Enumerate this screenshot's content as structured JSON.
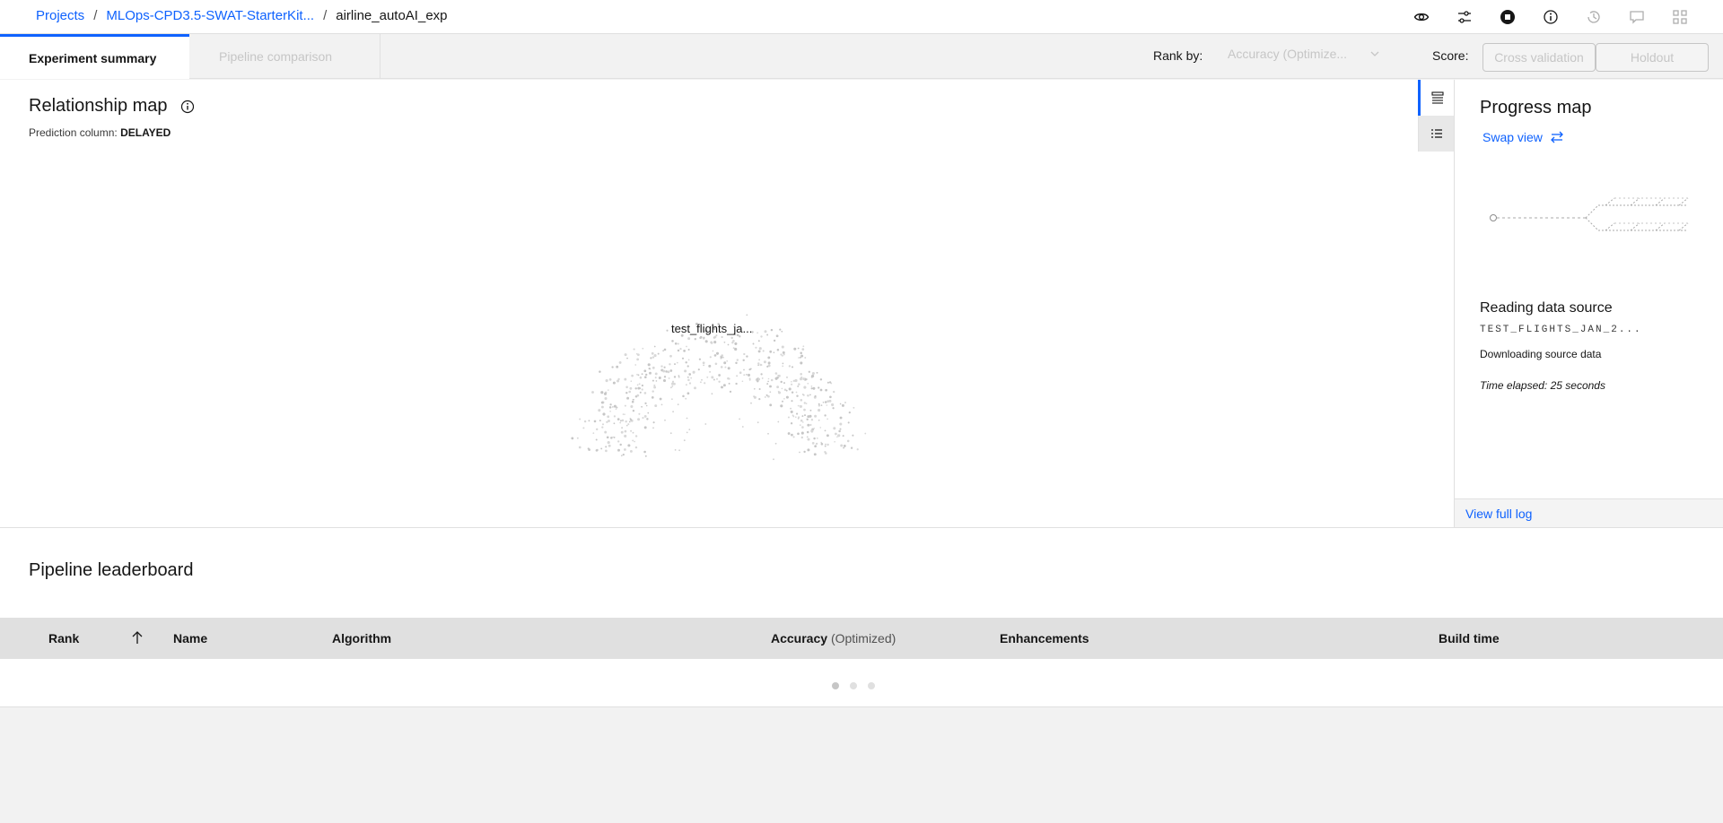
{
  "breadcrumb": {
    "items": [
      "Projects",
      "MLOps-CPD3.5-SWAT-StarterKit...",
      "airline_autoAI_exp"
    ],
    "separator": "/"
  },
  "toolbar": {
    "icons": [
      "eye-icon",
      "settings-adjust-icon",
      "stop-icon",
      "information-icon",
      "history-icon",
      "chat-icon",
      "data-structure-icon"
    ]
  },
  "tabs": {
    "experiment_summary": "Experiment summary",
    "pipeline_comparison": "Pipeline comparison"
  },
  "rank": {
    "label": "Rank by:",
    "selected": "Accuracy (Optimize..."
  },
  "score": {
    "label": "Score:",
    "cross_validation": "Cross validation",
    "holdout": "Holdout"
  },
  "relationship_map": {
    "title": "Relationship map",
    "prediction_label": "Prediction column:",
    "prediction_value": "DELAYED",
    "node_label": "test_flights_ja..."
  },
  "progress_map": {
    "title": "Progress map",
    "swap_view": "Swap view",
    "stage_title": "Reading data source",
    "source_name": "TEST_FLIGHTS_JAN_2...",
    "status": "Downloading source data",
    "elapsed": "Time elapsed: 25 seconds",
    "view_log": "View full log"
  },
  "leaderboard": {
    "title": "Pipeline leaderboard",
    "columns": {
      "rank": "Rank",
      "name": "Name",
      "algorithm": "Algorithm",
      "accuracy": "Accuracy",
      "accuracy_note": "(Optimized)",
      "enhancements": "Enhancements",
      "build_time": "Build time"
    }
  },
  "colors": {
    "accent": "#0f62fe",
    "disabled_text": "#c6c6c6",
    "header_bg": "#e0e0e0"
  }
}
